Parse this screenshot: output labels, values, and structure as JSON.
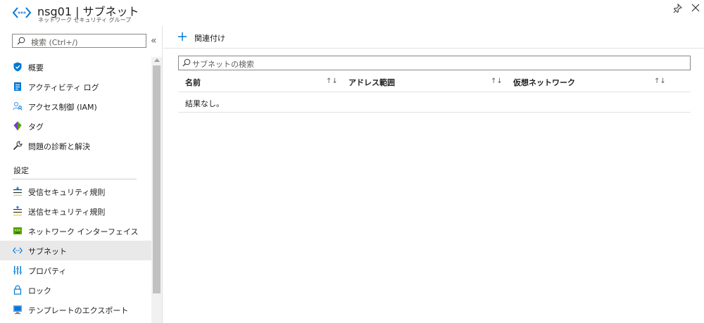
{
  "header": {
    "title": "nsg01 | サブネット",
    "subtitle": "ネットワーク セキュリティ グループ",
    "icon": "subnet-icon"
  },
  "sidebar": {
    "search_placeholder": "検索 (Ctrl+/)",
    "collapse_glyph": "«",
    "items_top": [
      {
        "label": "概要",
        "icon": "shield-icon"
      },
      {
        "label": "アクティビティ ログ",
        "icon": "activity-log-icon"
      },
      {
        "label": "アクセス制御 (IAM)",
        "icon": "iam-icon"
      },
      {
        "label": "タグ",
        "icon": "tag-icon"
      },
      {
        "label": "問題の診断と解決",
        "icon": "wrench-icon"
      }
    ],
    "section_settings": "設定",
    "items_settings": [
      {
        "label": "受信セキュリティ規則",
        "icon": "inbound-rules-icon"
      },
      {
        "label": "送信セキュリティ規則",
        "icon": "outbound-rules-icon"
      },
      {
        "label": "ネットワーク インターフェイス",
        "icon": "network-interface-icon"
      },
      {
        "label": "サブネット",
        "icon": "subnet-icon",
        "active": true
      },
      {
        "label": "プロパティ",
        "icon": "properties-icon"
      },
      {
        "label": "ロック",
        "icon": "lock-icon"
      },
      {
        "label": "テンプレートのエクスポート",
        "icon": "export-template-icon"
      }
    ]
  },
  "toolbar": {
    "associate_label": "関連付け"
  },
  "filter": {
    "placeholder": "サブネットの検索"
  },
  "table": {
    "columns": [
      "名前",
      "アドレス範囲",
      "仮想ネットワーク"
    ],
    "sort_glyph": "↑↓",
    "empty_text": "結果なし。"
  },
  "colors": {
    "accent": "#0078d4",
    "active_bg": "#e9e9e9",
    "border": "#8a8886"
  }
}
